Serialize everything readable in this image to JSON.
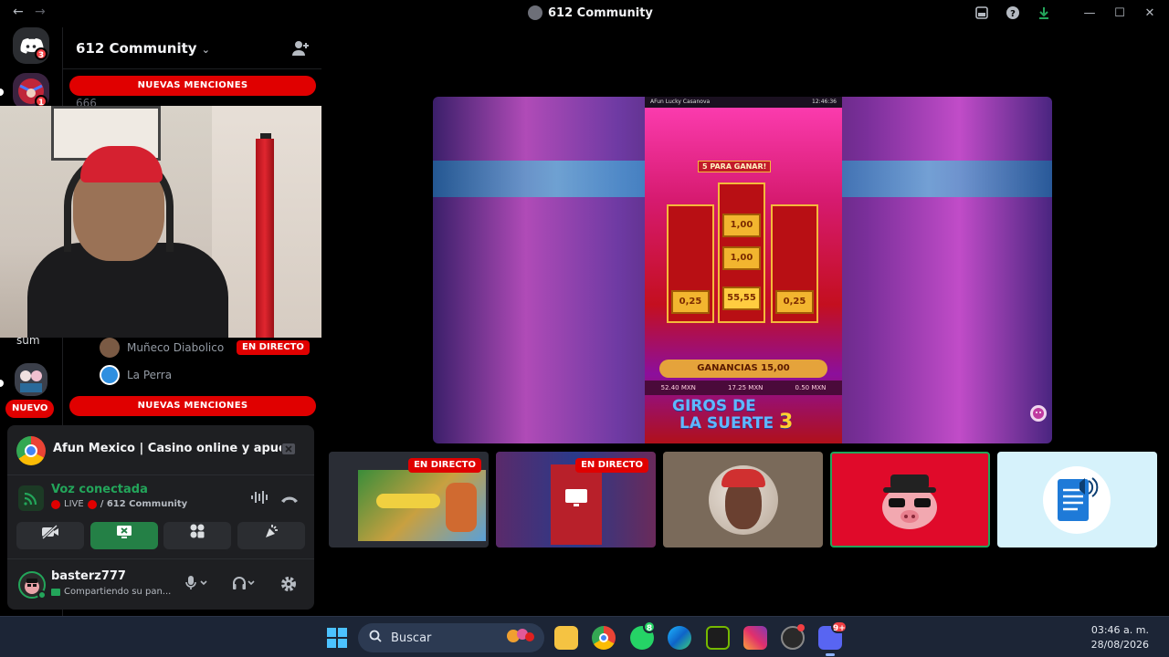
{
  "window": {
    "title": "612 Community"
  },
  "rail": {
    "home_badge": "3",
    "server_badge": "1",
    "partial_label": "sum"
  },
  "sidebar": {
    "server_name": "612 Community",
    "mention_top": "NUEVAS MENCIONES",
    "mention_bottom": "NUEVAS MENCIONES",
    "hidden_fragment": "666",
    "new_label": "NUEVO",
    "voice_users": [
      {
        "name": "Muñeco Diabolico",
        "live": "EN DIRECTO"
      },
      {
        "name": "La Perra"
      }
    ]
  },
  "activity": {
    "title": "Afun Mexico | Casino online y apues..."
  },
  "voice": {
    "status": "Voz conectada",
    "live_label": "LIVE",
    "channel": "/ 612 Community"
  },
  "user": {
    "name": "basterz777",
    "status": "Compartiendo su pan..."
  },
  "stream": {
    "slot_header": "AFun Lucky Casanova",
    "slot_time": "12:46:36",
    "slot_banner": "5 PARA GANAR!",
    "tiles": [
      "1,00",
      "1,00",
      "0,25",
      "55,55",
      "0,25"
    ],
    "winnings": "GANANCIAS 15,00",
    "info": [
      "52.40 MXN",
      "17.25 MXN",
      "0.50 MXN"
    ],
    "giros_line1": "GIROS DE",
    "giros_line2": "LA SUERTE",
    "giros_count": "3"
  },
  "thumbs": [
    {
      "live": "EN DIRECTO"
    },
    {
      "live": "EN DIRECTO"
    }
  ],
  "taskbar": {
    "search_placeholder": "Buscar",
    "whatsapp_badge": "8",
    "discord_badge": "9+",
    "time": "03:46 a. m.",
    "date": "28/08/2026"
  },
  "colors": {
    "live_red": "#e00000",
    "green": "#23a55a",
    "discord": "#5865f2"
  }
}
